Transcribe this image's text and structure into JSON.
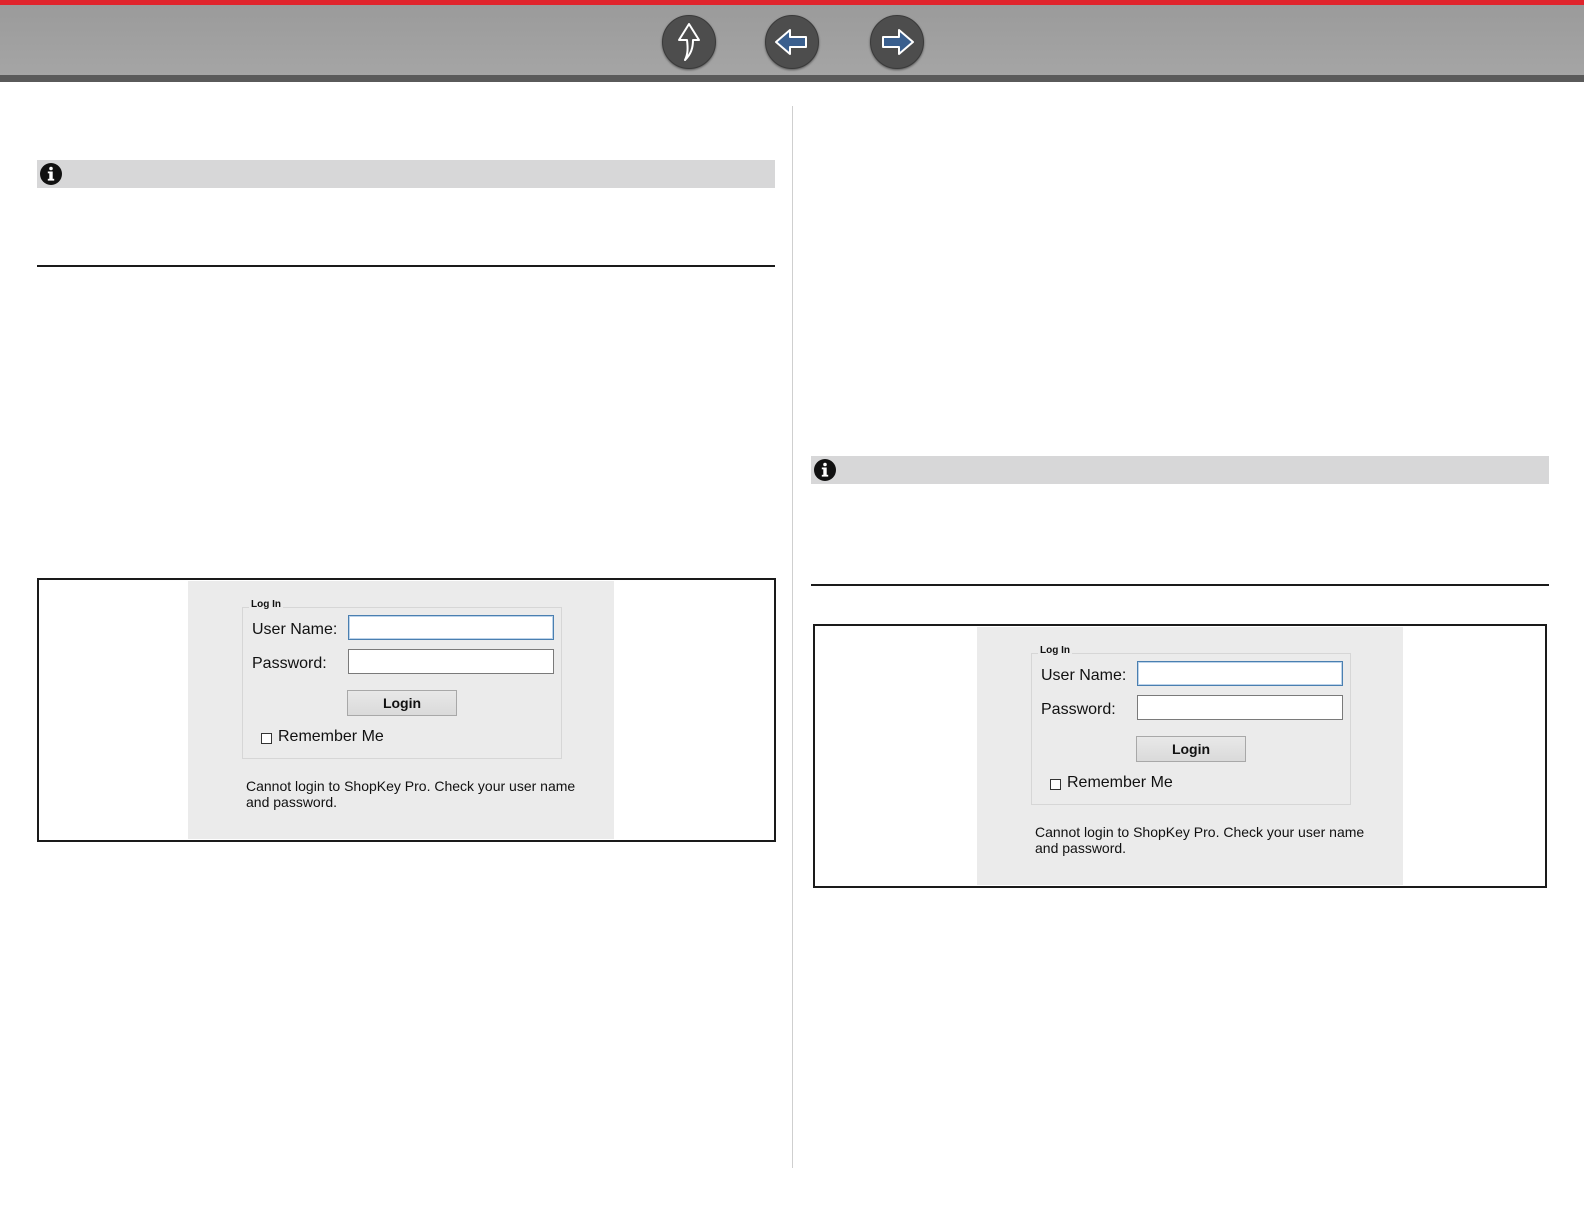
{
  "colors": {
    "accent": "#e0242c",
    "toolbar": "#a0a0a0",
    "info_bar": "#d7d7d8"
  },
  "toolbar": {
    "buttons": [
      {
        "icon": "up-arrow-icon"
      },
      {
        "icon": "back-arrow-icon"
      },
      {
        "icon": "forward-arrow-icon"
      }
    ]
  },
  "login_dialog": {
    "legend": "Log In",
    "username_label": "User Name:",
    "password_label": "Password:",
    "username_value": "",
    "password_value": "",
    "login_button": "Login",
    "remember_label": "Remember Me",
    "remember_checked": false,
    "error_message": "Cannot login to ShopKey Pro. Check your user name and password."
  },
  "icons": {
    "info": "info-icon"
  }
}
